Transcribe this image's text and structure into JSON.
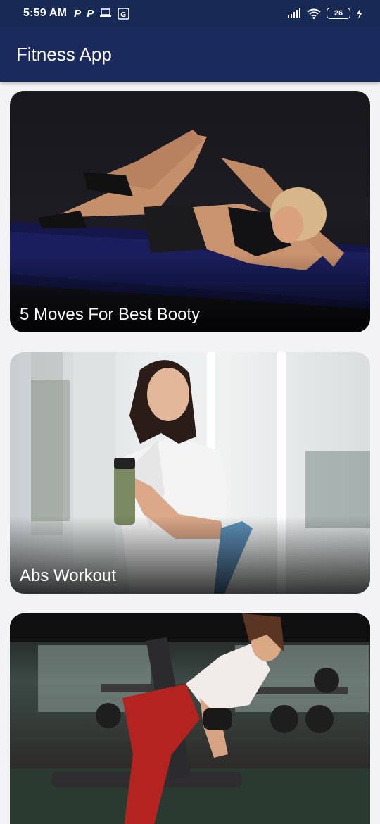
{
  "status_bar": {
    "time": "5:59 AM",
    "left_icons": [
      "P",
      "P",
      "laptop-icon",
      "translate-icon"
    ],
    "battery": "26"
  },
  "app_bar": {
    "title": "Fitness App"
  },
  "cards": [
    {
      "title": "5 Moves For Best Booty"
    },
    {
      "title": "Abs Workout"
    },
    {
      "title": ""
    }
  ],
  "colors": {
    "app_bar": "#1a2a5c",
    "status_bar": "#172a56",
    "background": "#f3f3f6"
  }
}
